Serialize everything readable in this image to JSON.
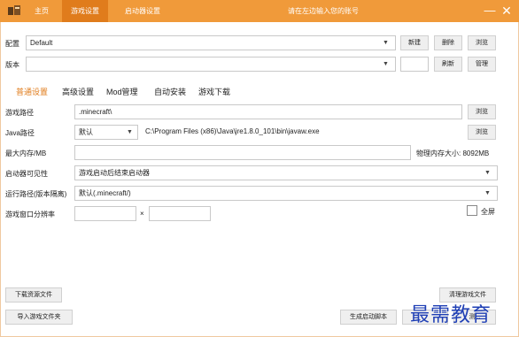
{
  "titlebar": {
    "tabs": [
      "主页",
      "游戏设置",
      "启动器设置"
    ],
    "account_hint": "请在左边输入您的账号",
    "minimize": "—",
    "close": "✕",
    "colors": {
      "bar": "#f09a3a",
      "active_tab": "#e07c1c"
    }
  },
  "profile": {
    "label": "配置",
    "value": "Default",
    "buttons": [
      "新建",
      "删除",
      "浏览"
    ]
  },
  "version": {
    "label": "版本",
    "value": "",
    "buttons": [
      "刷新",
      "管理"
    ]
  },
  "subtabs": [
    "普通设置",
    "高级设置",
    "Mod管理",
    "自动安装",
    "游戏下载"
  ],
  "game_path": {
    "label": "游戏路径",
    "value": ".minecraft\\",
    "button": "浏览"
  },
  "java_path": {
    "label": "Java路径",
    "select": "默认",
    "value": "C:\\Program Files (x86)\\Java\\jre1.8.0_101\\bin\\javaw.exe",
    "button": "浏览"
  },
  "memory": {
    "label": "最大内存/MB",
    "value": "",
    "physical": "物理内存大小: 8092MB"
  },
  "launcher_visibility": {
    "label": "启动器可见性",
    "value": "游戏启动后结束启动器"
  },
  "run_path": {
    "label": "运行路径(版本隔离)",
    "value": "默认(.minecraft/)"
  },
  "resolution": {
    "label": "游戏窗口分辨率",
    "width": "",
    "x": "×",
    "height": "",
    "fullscreen": "全屏"
  },
  "bottom": {
    "download_resources": "下载资源文件",
    "import_game": "导入游戏文件夹",
    "generate_script": "生成启动脚本",
    "clean_game": "清理游戏文件",
    "hidden_button_1": "",
    "hidden_button_2": "测..."
  },
  "watermark": "最需教育",
  "icons": [
    "app-logo-icon",
    "chevron-down-icon",
    "minimize-icon",
    "close-icon",
    "checkbox-icon"
  ]
}
